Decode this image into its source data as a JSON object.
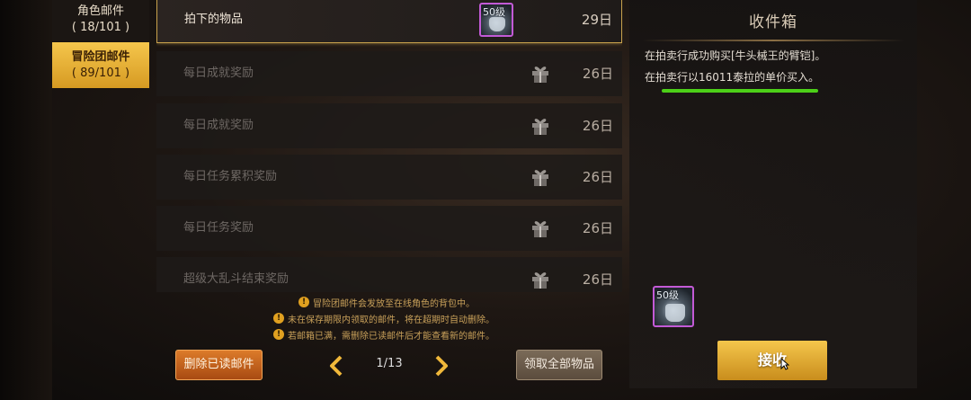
{
  "sidebar": {
    "tabs": [
      {
        "label": "角色邮件",
        "count": "( 18/101 )"
      },
      {
        "label": "冒险团邮件",
        "count": "( 89/101 )"
      }
    ]
  },
  "mail_list": {
    "rows": [
      {
        "title": "拍下的物品",
        "day": "29日",
        "attachment": "item-icon",
        "item_level": "50级"
      },
      {
        "title": "每日成就奖励",
        "day": "26日",
        "attachment": "gift-icon"
      },
      {
        "title": "每日成就奖励",
        "day": "26日",
        "attachment": "gift-icon"
      },
      {
        "title": "每日任务累积奖励",
        "day": "26日",
        "attachment": "gift-icon"
      },
      {
        "title": "每日任务奖励",
        "day": "26日",
        "attachment": "gift-icon"
      },
      {
        "title": "超级大乱斗结束奖励",
        "day": "26日",
        "attachment": "gift-icon"
      }
    ]
  },
  "notices": [
    "冒险团邮件会发放至在线角色的背包中。",
    "未在保存期限内领取的邮件，将在超期时自动删除。",
    "若邮箱已满，需删除已读邮件后才能查看新的邮件。"
  ],
  "bottom_bar": {
    "delete_read_label": "删除已读邮件",
    "page": "1/13",
    "claim_all_label": "领取全部物品"
  },
  "detail": {
    "title": "收件箱",
    "line1": "在拍卖行成功购买[牛头械王的臂铠]。",
    "line2": "在拍卖行以16011泰拉的单价买入。",
    "item_level": "50级",
    "receive_label": "接收"
  },
  "colors": {
    "accent_gold": "#f5c64c",
    "delete_orange": "#dc7b2a",
    "highlight_green": "#4ccf18",
    "item_border_purple": "#c35ad6"
  }
}
